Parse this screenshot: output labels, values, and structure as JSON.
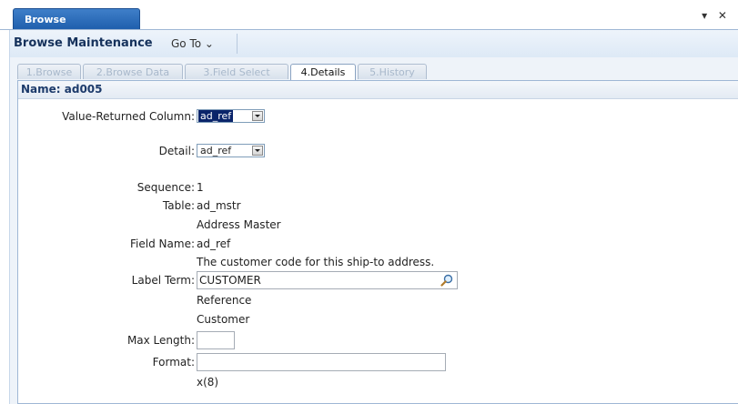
{
  "window": {
    "tab_title": "Browse Maintenance",
    "controls": "▾ ✕"
  },
  "toolbar": {
    "title": "Browse Maintenance",
    "goto_label": "Go To ⌄"
  },
  "tabs": [
    {
      "label": "1.Browse",
      "active": false
    },
    {
      "label": "2.Browse Data",
      "active": false
    },
    {
      "label": "3.Field Select",
      "active": false
    },
    {
      "label": "4.Details",
      "active": true
    },
    {
      "label": "5.History",
      "active": false
    }
  ],
  "panel": {
    "header": "Name: ad005"
  },
  "form": {
    "value_returned_label": "Value-Returned Column:",
    "value_returned_value": "ad_ref",
    "detail_label": "Detail:",
    "detail_value": "ad_ref",
    "sequence_label": "Sequence:",
    "sequence_value": "1",
    "table_label": "Table:",
    "table_value": "ad_mstr",
    "table_desc": "Address Master",
    "field_name_label": "Field Name:",
    "field_name_value": "ad_ref",
    "field_desc": "The customer code for this ship-to address.",
    "label_term_label": "Label Term:",
    "label_term_value": "CUSTOMER",
    "label_term_short": "Reference",
    "label_term_long": "Customer",
    "max_length_label": "Max Length:",
    "max_length_value": "",
    "format_label": "Format:",
    "format_value": "",
    "format_default": "x(8)"
  },
  "icons": {
    "lookup": "magnifier-icon",
    "dropdown": "chevron-down-icon"
  },
  "colors": {
    "accent": "#1f5fad",
    "selection": "#0a246a",
    "panel_border": "#9fb7d5"
  }
}
